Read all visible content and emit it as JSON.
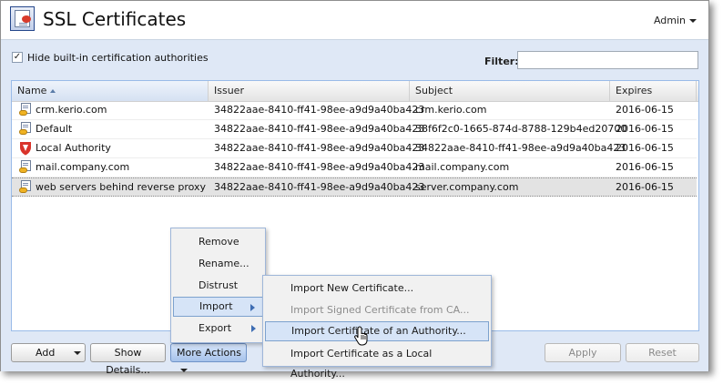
{
  "app": {
    "title": "SSL Certificates",
    "user_menu": "Admin"
  },
  "toolbar": {
    "hide_builtin_label": "Hide built-in certification authorities",
    "hide_builtin_checked": true,
    "filter_label": "Filter:",
    "filter_value": ""
  },
  "grid": {
    "columns": [
      "Name",
      "Issuer",
      "Subject",
      "Expires"
    ],
    "rows": [
      {
        "icon": "certificate-icon",
        "name": "crm.kerio.com",
        "issuer": "34822aae-8410-ff41-98ee-a9d9a40ba423",
        "subject": "crm.kerio.com",
        "expires": "2016-06-15"
      },
      {
        "icon": "certificate-icon",
        "name": "Default",
        "issuer": "34822aae-8410-ff41-98ee-a9d9a40ba423",
        "subject": "38f6f2c0-1665-874d-8788-129b4ed20700",
        "expires": "2016-06-15"
      },
      {
        "icon": "shield-icon",
        "name": "Local Authority",
        "issuer": "34822aae-8410-ff41-98ee-a9d9a40ba423",
        "subject": "34822aae-8410-ff41-98ee-a9d9a40ba423",
        "expires": "2016-06-15"
      },
      {
        "icon": "certificate-icon",
        "name": "mail.company.com",
        "issuer": "34822aae-8410-ff41-98ee-a9d9a40ba423",
        "subject": "mail.company.com",
        "expires": "2016-06-15"
      },
      {
        "icon": "certificate-icon",
        "name": "web servers behind reverse proxy",
        "issuer": "34822aae-8410-ff41-98ee-a9d9a40ba423",
        "subject": "server.company.com",
        "expires": "2016-06-15"
      }
    ]
  },
  "buttons": {
    "add": "Add",
    "show_details": "Show Details...",
    "more_actions": "More Actions",
    "apply": "Apply",
    "reset": "Reset"
  },
  "more_actions_menu": [
    "Remove",
    "Rename...",
    "Distrust",
    "Import",
    "Export"
  ],
  "import_submenu": [
    "Import New Certificate...",
    "Import Signed Certificate from CA...",
    "Import Certificate of an Authority...",
    "Import Certificate as a Local Authority..."
  ],
  "colors": {
    "accent": "#99bbe8",
    "panel_bg": "#dfe8f6",
    "menu_highlight": "#d6e4f7",
    "shield": "#d9332a",
    "key": "#f0b323"
  }
}
